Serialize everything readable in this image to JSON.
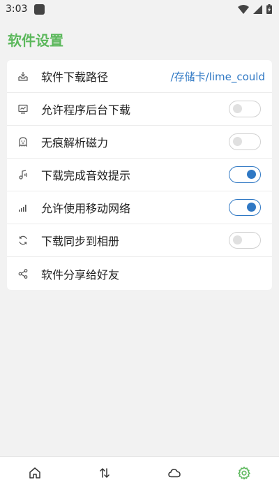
{
  "status_bar": {
    "time": "3:03",
    "icons": [
      "app-icon",
      "wifi-icon",
      "signal-icon",
      "battery-charging-icon"
    ]
  },
  "header": {
    "title": "软件设置"
  },
  "settings": [
    {
      "icon": "download-tray-icon",
      "label": "软件下载路径",
      "value": "/存储卡/lime_could"
    },
    {
      "icon": "monitor-chart-icon",
      "label": "允许程序后台下载",
      "toggle": "off"
    },
    {
      "icon": "ghost-icon",
      "label": "无痕解析磁力",
      "toggle": "off"
    },
    {
      "icon": "music-note-icon",
      "label": "下载完成音效提示",
      "toggle": "on"
    },
    {
      "icon": "signal-bars-icon",
      "label": "允许使用移动网络",
      "toggle": "on"
    },
    {
      "icon": "sync-icon",
      "label": "下载同步到相册",
      "toggle": "off"
    },
    {
      "icon": "share-icon",
      "label": "软件分享给好友"
    }
  ],
  "bottom_nav": {
    "items": [
      "home-icon",
      "transfer-icon",
      "cloud-icon",
      "settings-gear-icon"
    ],
    "active": "settings-gear-icon"
  },
  "colors": {
    "accent_green": "#5cb85c",
    "accent_blue": "#2f78c4",
    "background": "#f2f2f2"
  }
}
